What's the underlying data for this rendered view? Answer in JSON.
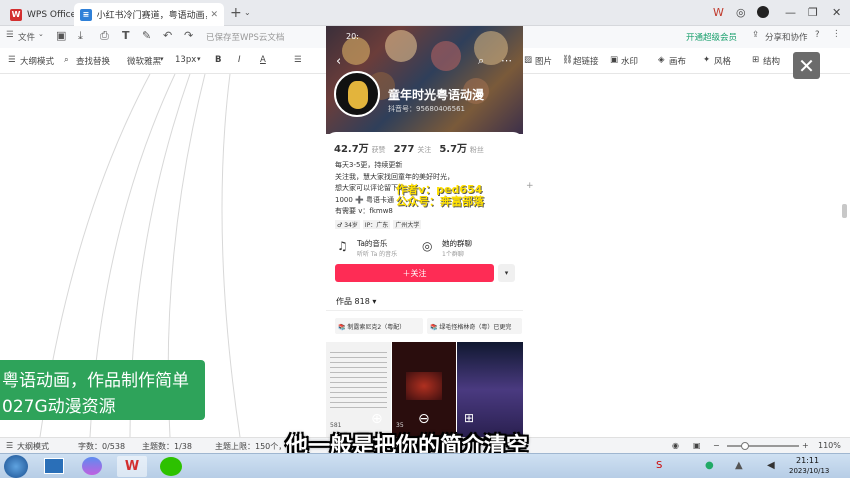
{
  "tabs": [
    {
      "label": "WPS Office"
    },
    {
      "label": "小红书冷门赛道，粤语动画，作品..."
    }
  ],
  "menu": {
    "file": "文件",
    "saved_status": "已保存至WPS云文档",
    "upgrade": "开通超级会员",
    "share": "分享和协作"
  },
  "toolbar": {
    "outline": "大纲模式",
    "find_replace": "查找替换",
    "font": "微软雅黑",
    "size": "13px",
    "image": "图片",
    "link": "超链接",
    "watermark": "水印",
    "canvas": "画布",
    "style": "风格",
    "structure": "结构"
  },
  "phone": {
    "time": "20:",
    "name": "童年时光粤语动漫",
    "account": "抖音号：95680406561",
    "stats": [
      {
        "num": "42.7万",
        "label": "获赞"
      },
      {
        "num": "277",
        "label": "关注"
      },
      {
        "num": "5.7万",
        "label": "粉丝"
      }
    ],
    "bio": [
      "每天3-5更，持续更新",
      "关注我，慧大家找回童年的美好时光，",
      "想大家可以评论留下你",
      "1000 ➕ 粤语卡通",
      "有需要 v：fkmw8"
    ],
    "bio_tail": "通片,",
    "watermark_line1": "作者v：ped654",
    "watermark_line2": "公众号：奔富部落",
    "tags": [
      "♂ 34岁",
      "IP：广东",
      "广州大学"
    ],
    "music_title": "Ta的音乐",
    "music_sub": "听听 Ta 的音乐",
    "group_title": "她的群聊",
    "group_sub": "1个群聊",
    "follow": "＋关注",
    "works": "作品 818 ▾",
    "collections": [
      "📚 制露索尼克2（粤配）",
      "📚 绿毛怪格林奇（粤）已更完"
    ],
    "likes": [
      "581",
      "35"
    ]
  },
  "green_banner": {
    "line1": "粤语动画，作品制作简单",
    "line2": "027G动漫资源"
  },
  "subtitle": "他一般是把你的简介清空",
  "status": {
    "mode": "大纲模式",
    "chars": "字数：0/538",
    "topics": "主题数：1/38",
    "limit": "主题上限：150个，...",
    "zoom": "110%"
  },
  "taskbar": {
    "time": "21:11",
    "date": "2023/10/13"
  },
  "colors": {
    "follow": "#fe2c55",
    "green": "#2ea35a",
    "wps_red": "#d32f2f"
  }
}
